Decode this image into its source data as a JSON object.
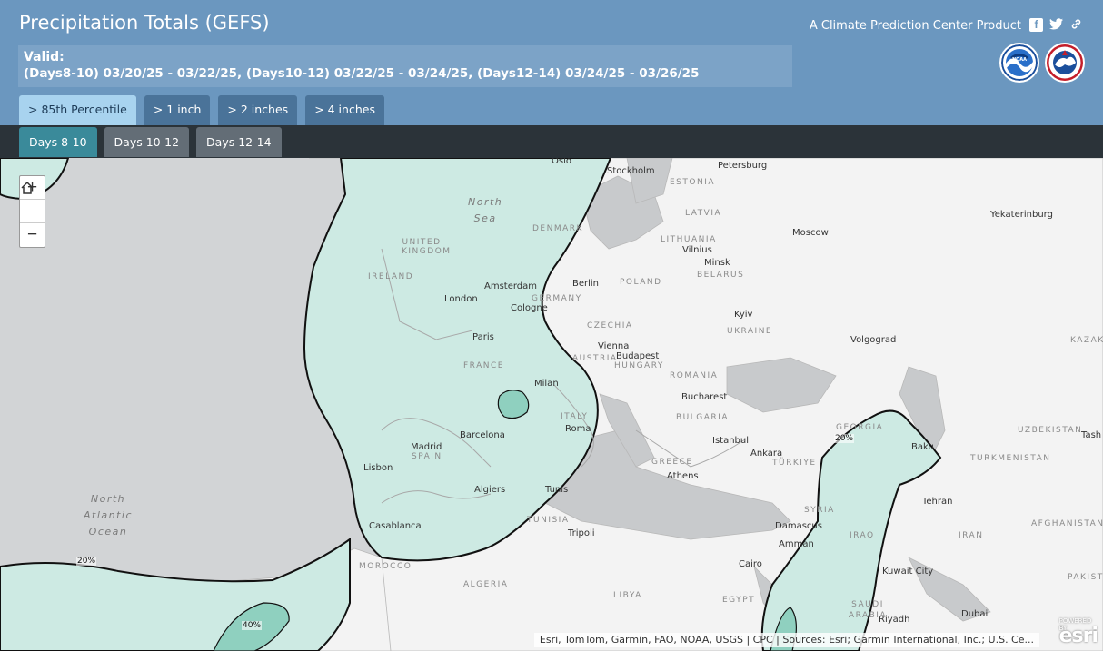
{
  "header": {
    "title": "Precipitation Totals (GEFS)",
    "product": "A Climate Prediction Center Product",
    "valid_label": "Valid:",
    "valid_range": "(Days8-10) 03/20/25 - 03/22/25, (Days10-12) 03/22/25 - 03/24/25, (Days12-14) 03/24/25 - 03/26/25",
    "social": [
      "facebook-icon",
      "twitter-icon",
      "link-icon"
    ]
  },
  "threshold_tabs": [
    {
      "label": "> 85th Percentile",
      "active": true
    },
    {
      "label": "> 1 inch",
      "active": false
    },
    {
      "label": "> 2 inches",
      "active": false
    },
    {
      "label": "> 4 inches",
      "active": false
    }
  ],
  "period_tabs": [
    {
      "label": "Days 8-10",
      "active": true
    },
    {
      "label": "Days 10-12",
      "active": false
    },
    {
      "label": "Days 12-14",
      "active": false
    }
  ],
  "map": {
    "zoom": {
      "in": "+",
      "home": "home-icon",
      "out": "−"
    },
    "seas": {
      "north_sea": "North\nSea",
      "atlantic": "North\nAtlantic\nOcean"
    },
    "cities": [
      "Oslo",
      "Stockholm",
      "Petersburg",
      "Moscow",
      "Yekaterinburg",
      "Vilnius",
      "Minsk",
      "Berlin",
      "Amsterdam",
      "London",
      "Cologne",
      "Paris",
      "Kyiv",
      "Volgograd",
      "Vienna",
      "Budapest",
      "Milan",
      "Bucharest",
      "Roma",
      "Istanbul",
      "Ankara",
      "Baku",
      "Madrid",
      "Barcelona",
      "Lisbon",
      "Algiers",
      "Tunis",
      "Athens",
      "Tehran",
      "Tripoli",
      "Casablanca",
      "Damascus",
      "Amman",
      "Cairo",
      "Kuwait City",
      "Riyadh",
      "Dubai"
    ],
    "countries": [
      "ESTONIA",
      "LATVIA",
      "LITHUANIA",
      "BELARUS",
      "UNITED KINGDOM",
      "IRELAND",
      "DENMARK",
      "POLAND",
      "GERMANY",
      "CZECHIA",
      "UKRAINE",
      "AUSTRIA",
      "HUNGARY",
      "ROMANIA",
      "FRANCE",
      "BULGARIA",
      "ITALY",
      "SPAIN",
      "GREECE",
      "TÜRKIYE",
      "GEORGIA",
      "UZBEKISTAN",
      "TURKMENISTAN",
      "KAZAK",
      "SYRIA",
      "IRAQ",
      "IRAN",
      "AFGHANISTAN",
      "PAKIST",
      "TUNISIA",
      "MOROCCO",
      "ALGERIA",
      "LIBYA",
      "EGYPT",
      "SAUDI ARABIA",
      "Tash"
    ],
    "contour_labels": [
      "20%",
      "20%",
      "40%"
    ],
    "attribution": "Esri, TomTom, Garmin, FAO, NOAA, USGS | CPC | Sources: Esri; Garmin International, Inc.; U.S. Ce...",
    "esri_brand": "esri",
    "esri_powered": "POWERED BY"
  }
}
